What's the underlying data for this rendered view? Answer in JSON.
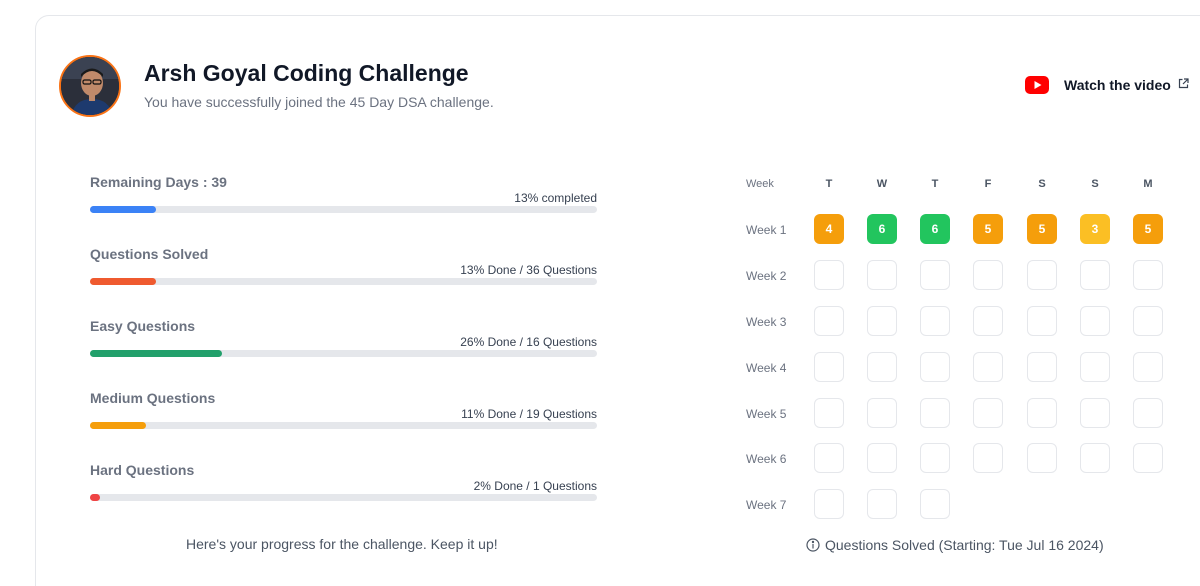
{
  "header": {
    "title": "Arsh Goyal Coding Challenge",
    "subtitle": "You have successfully joined the 45 Day DSA challenge.",
    "avatar_icon": "user-avatar",
    "watch_label": "Watch the video",
    "watch_icon": "youtube-icon",
    "external_icon": "external-link-icon"
  },
  "progress": [
    {
      "label": "Remaining Days : 39",
      "status": "13% completed",
      "percent": 13,
      "color": "#3b82f6"
    },
    {
      "label": "Questions Solved",
      "status": "13% Done / 36 Questions",
      "percent": 13,
      "color": "#ef5a2f"
    },
    {
      "label": "Easy Questions",
      "status": "26% Done / 16 Questions",
      "percent": 26,
      "color": "#22a06b"
    },
    {
      "label": "Medium Questions",
      "status": "11% Done / 19 Questions",
      "percent": 11,
      "color": "#f59e0b"
    },
    {
      "label": "Hard Questions",
      "status": "2% Done / 1 Questions",
      "percent": 2,
      "color": "#ef4444"
    }
  ],
  "progress_footer": "Here's your progress for the challenge. Keep it up!",
  "calendar": {
    "week_header": "Week",
    "days": [
      "T",
      "W",
      "T",
      "F",
      "S",
      "S",
      "M"
    ],
    "weeks": [
      {
        "label": "Week 1",
        "cells": [
          {
            "value": "4",
            "color": "#f59e0b"
          },
          {
            "value": "6",
            "color": "#22c55e"
          },
          {
            "value": "6",
            "color": "#22c55e"
          },
          {
            "value": "5",
            "color": "#f59e0b"
          },
          {
            "value": "5",
            "color": "#f59e0b"
          },
          {
            "value": "3",
            "color": "#fbbf24"
          },
          {
            "value": "5",
            "color": "#f59e0b"
          }
        ]
      },
      {
        "label": "Week 2",
        "cells": [
          null,
          null,
          null,
          null,
          null,
          null,
          null
        ]
      },
      {
        "label": "Week 3",
        "cells": [
          null,
          null,
          null,
          null,
          null,
          null,
          null
        ]
      },
      {
        "label": "Week 4",
        "cells": [
          null,
          null,
          null,
          null,
          null,
          null,
          null
        ]
      },
      {
        "label": "Week 5",
        "cells": [
          null,
          null,
          null,
          null,
          null,
          null,
          null
        ]
      },
      {
        "label": "Week 6",
        "cells": [
          null,
          null,
          null,
          null,
          null,
          null,
          null
        ]
      },
      {
        "label": "Week 7",
        "cells": [
          null,
          null,
          null
        ]
      }
    ],
    "info_icon": "info-icon",
    "footer": "Questions Solved (Starting: Tue Jul 16 2024)"
  }
}
